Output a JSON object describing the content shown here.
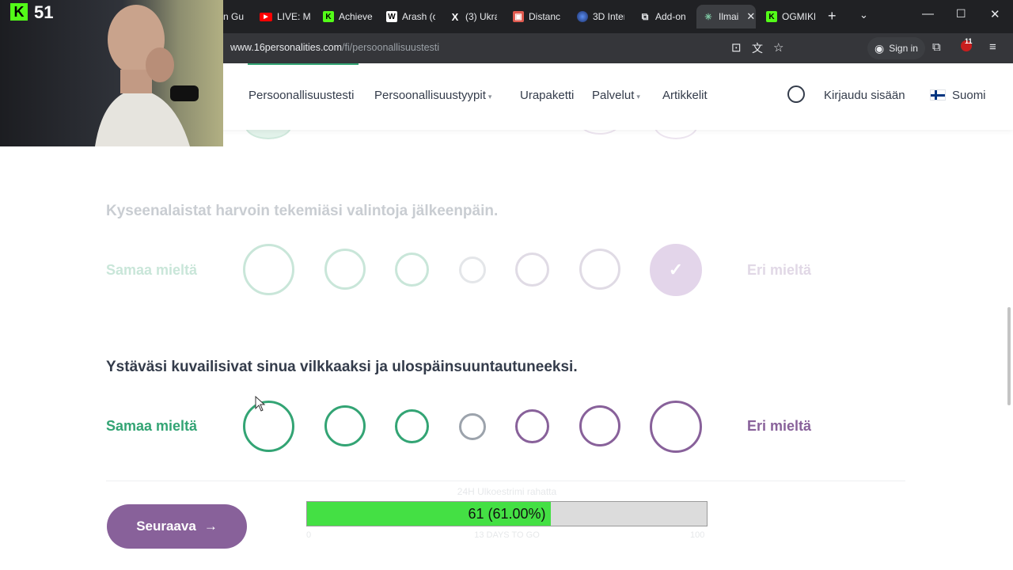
{
  "browser": {
    "tabs": [
      {
        "label": "n Gu",
        "favicon": "generic",
        "active": false
      },
      {
        "label": "LIVE: Mi",
        "favicon": "youtube-icon",
        "active": false
      },
      {
        "label": "Achieve",
        "favicon": "kick-icon",
        "active": false
      },
      {
        "label": "Arash (c",
        "favicon": "wikipedia-icon",
        "active": false
      },
      {
        "label": "(3) Ukra",
        "favicon": "x-icon",
        "active": false
      },
      {
        "label": "Distanc",
        "favicon": "generic-red",
        "active": false
      },
      {
        "label": "3D Inter",
        "favicon": "globe-icon",
        "active": false
      },
      {
        "label": "Add-on",
        "favicon": "puzzle-icon",
        "active": false
      },
      {
        "label": "Ilmai",
        "favicon": "16p-icon",
        "active": true
      },
      {
        "label": "OGMIKE",
        "favicon": "kick-icon",
        "active": false
      }
    ],
    "url_host": "www.16personalities.com",
    "url_path": "/fi/persoonallisuustesti",
    "sign_in_label": "Sign in",
    "extension_badge_count": "11"
  },
  "webcam": {
    "platform_logo": "K",
    "viewer_count": "51"
  },
  "site_nav": {
    "items": [
      {
        "label": "Persoonallisuustesti",
        "has_dropdown": false,
        "active": true
      },
      {
        "label": "Persoonallisuustyypit",
        "has_dropdown": true
      },
      {
        "label": "Urapaketti",
        "has_dropdown": false
      },
      {
        "label": "Palvelut",
        "has_dropdown": true
      },
      {
        "label": "Artikkelit",
        "has_dropdown": false
      }
    ],
    "login_label": "Kirjaudu sisään",
    "language_label": "Suomi"
  },
  "questions": [
    {
      "text": "Kyseenalaistat harvoin tekemiäsi valintoja jälkeenpäin.",
      "agree_label": "Samaa mieltä",
      "disagree_label": "Eri mieltä",
      "state": "answered",
      "selected_index": 6
    },
    {
      "text": "Ystäväsi kuvailisivat sinua vilkkaaksi ja ulospäinsuuntautuneeksi.",
      "agree_label": "Samaa mieltä",
      "disagree_label": "Eri mieltä",
      "state": "active",
      "selected_index": null
    }
  ],
  "next_button_label": "Seuraava",
  "stream_goal": {
    "title": "24H Ulkoestrimi rahatta",
    "progress_text": "61 (61.00%)",
    "progress_fraction": 0.61,
    "min_label": "0",
    "max_label": "100",
    "sub_label": "13 DAYS TO GO"
  },
  "colors": {
    "agree": "#33a474",
    "neutral": "#9ca3ac",
    "disagree": "#88619a",
    "kick_green": "#53fc18"
  }
}
